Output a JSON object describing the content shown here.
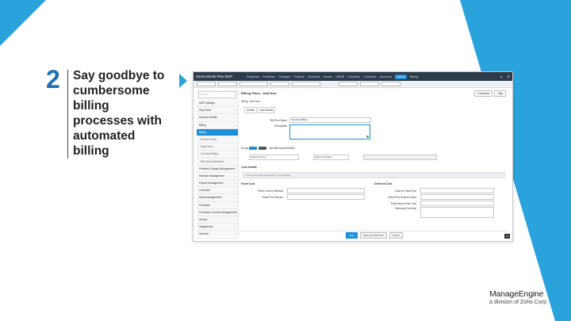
{
  "slide": {
    "step_number": "2",
    "step_text": "Say goodbye to cumbersome billing processes with automated billing"
  },
  "brand": {
    "name": "ManageEngine",
    "tagline": "a division of Zoho Corp."
  },
  "colors": {
    "accent": "#2aa3dd",
    "number": "#1d6fb3",
    "topbar": "#2c3a4a",
    "active": "#1d8fd8"
  },
  "app": {
    "logo": "ServiceDesk Plus MSP",
    "nav": [
      "Requests",
      "Problems",
      "Changes",
      "Projects",
      "Solutions",
      "Assets",
      "CMDB",
      "Purchase",
      "Contracts",
      "Accounts",
      "Admin",
      "Billing"
    ],
    "active_nav": "Admin",
    "sidebar": [
      {
        "label": "Search",
        "type": "search"
      },
      {
        "label": "MSP Settings",
        "chev": true
      },
      {
        "label": "Help Desk",
        "chev": true
      },
      {
        "label": "Account Details",
        "chev": true
      },
      {
        "label": "Billing",
        "chev": true
      },
      {
        "label": "Billing",
        "active": true
      },
      {
        "label": "Service Plans",
        "sub": true
      },
      {
        "label": "Map Plans",
        "sub": true
      },
      {
        "label": "Contract Billing",
        "sub": true
      },
      {
        "label": "Bill Cycle Definitions",
        "sub": true
      },
      {
        "label": "Problem/Change Management",
        "chev": true
      },
      {
        "label": "Release Management",
        "chev": true
      },
      {
        "label": "Project Management",
        "chev": true
      },
      {
        "label": "Contracts",
        "chev": true
      },
      {
        "label": "Asset Management",
        "chev": true
      },
      {
        "label": "Purchase",
        "chev": true
      },
      {
        "label": "Purchase Contract Management",
        "chev": true
      },
      {
        "label": "Survey",
        "chev": true
      },
      {
        "label": "Integrations",
        "chev": true
      },
      {
        "label": "General",
        "chev": true
      }
    ],
    "page_title": "Billing Plans - Add New",
    "page_buttons": [
      "Customize",
      "Help"
    ],
    "breadcrumb": "Billing - Add New",
    "tabs": [
      "Details",
      "Add Details"
    ],
    "fields": {
      "name_label": "* Bill Plan Name",
      "name_value": "Standard Billing",
      "desc_label": "Description"
    },
    "hourly": {
      "label": "Hourly",
      "toggle_on": "ON",
      "toggle_off": "OFF",
      "suffix": "Add Bill Amount/Others"
    },
    "selects": [
      "Select Service",
      "Select Condition"
    ],
    "cost_details_title": "Cost Details",
    "cost_bar_text": "If the amount/bill information is not applied",
    "fixed_cost_title": "Fixed Cost",
    "fixed_labels": [
      "Fixed Cost for Window",
      "Fixed Pool Service"
    ],
    "deferred_title": "Deferred Cost",
    "deferred_labels": [
      "Cost for Fixed Pool",
      "Fixed Pool Service Hours",
      "Fixed Hours Over Cost",
      "Warranty Cost Add"
    ],
    "footer_buttons": [
      "Save",
      "Save and Add New",
      "Cancel"
    ]
  }
}
